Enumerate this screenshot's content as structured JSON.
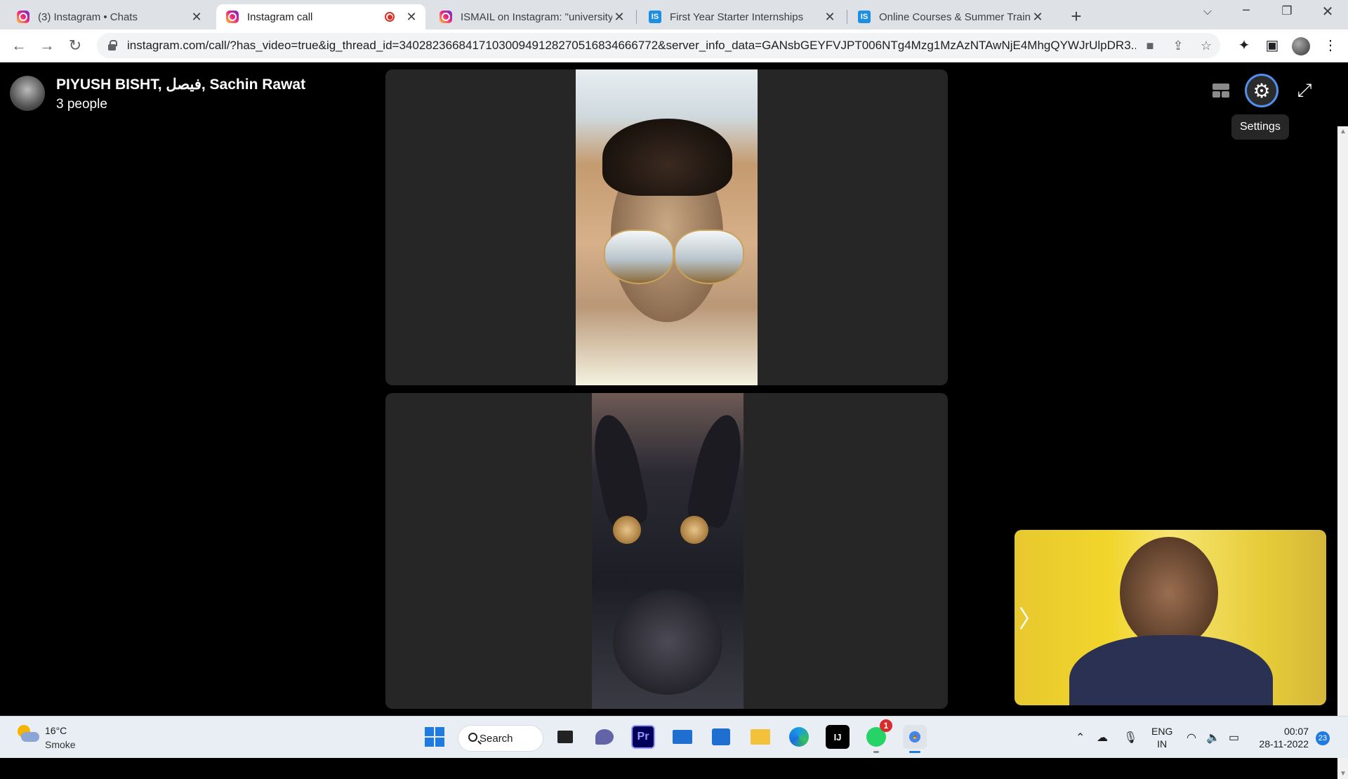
{
  "browser": {
    "tabs": [
      {
        "title": "(3) Instagram • Chats",
        "favicon": "instagram-icon"
      },
      {
        "title": "Instagram call",
        "favicon": "instagram-icon",
        "active": true,
        "recording": true
      },
      {
        "title": "ISMAIL on Instagram: \"university",
        "favicon": "instagram-icon"
      },
      {
        "title": "First Year Starter Internships",
        "favicon": "internshala-icon"
      },
      {
        "title": "Online Courses & Summer Traini",
        "favicon": "internshala-icon"
      }
    ],
    "favicon_text": "IS",
    "url": "instagram.com/call/?has_video=true&ig_thread_id=340282366841710300949128270516834666772&server_info_data=GANsbGEYFVJPT006NTg4Mzg1MzAzNTAwNjE4MhgQYWJrUlpDR3..."
  },
  "call": {
    "title": "PIYUSH BISHT, فيصل, Sachin Rawat",
    "subtitle": "3 people",
    "tooltip": "Settings"
  },
  "taskbar": {
    "weather_temp": "16°C",
    "weather_condition": "Smoke",
    "search_label": "Search",
    "premiere_label": "Pr",
    "intellij_label": "IJ",
    "whatsapp_badge": "1",
    "language": "ENG",
    "region": "IN",
    "time": "00:07",
    "date": "28-11-2022",
    "notification_count": "23"
  },
  "colors": {
    "accent": "#1f7be0",
    "settings_ring": "#4f90f0",
    "record_red": "#d93025"
  }
}
